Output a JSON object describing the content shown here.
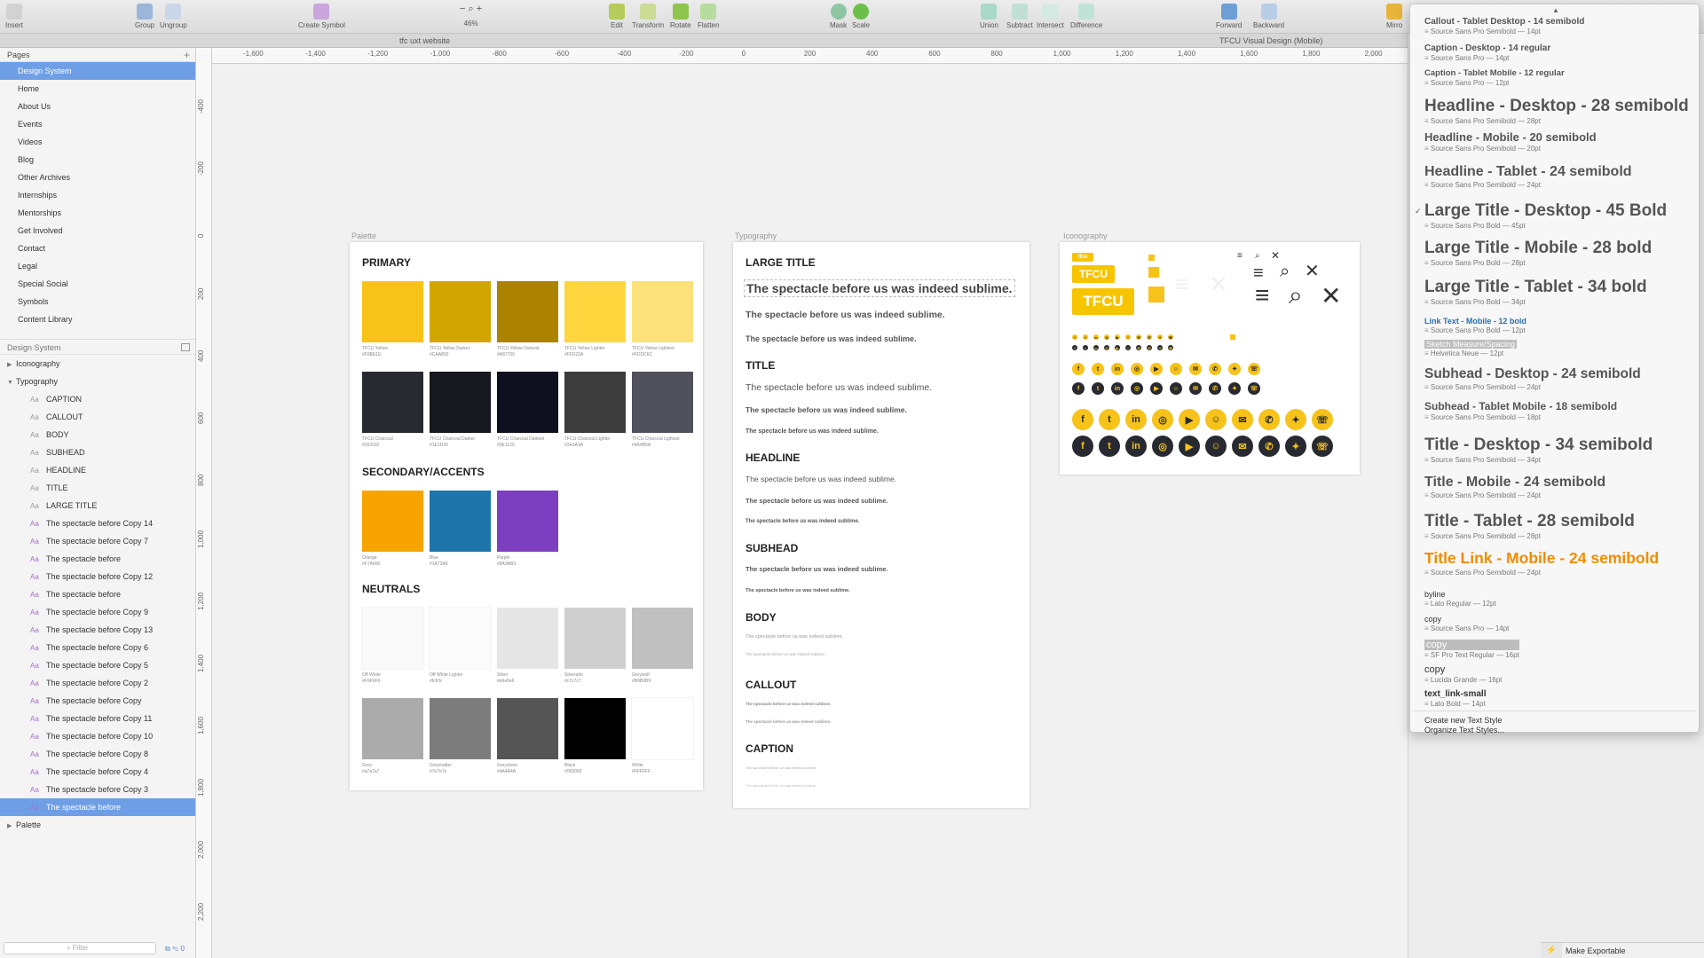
{
  "toolbar": {
    "insert": "Insert",
    "group": "Group",
    "ungroup": "Ungroup",
    "create_symbol": "Create Symbol",
    "zoom_minus": "−",
    "zoom_plus": "+",
    "zoom_level": "46%",
    "edit": "Edit",
    "transform": "Transform",
    "rotate": "Rotate",
    "flatten": "Flatten",
    "mask": "Mask",
    "scale": "Scale",
    "union": "Union",
    "subtract": "Subtract",
    "intersect": "Intersect",
    "difference": "Difference",
    "forward": "Forward",
    "backward": "Backward",
    "mirror": "Mirro"
  },
  "tabs": {
    "left": "tfc uxt website",
    "right": "TFCU Visual Design (Mobile)"
  },
  "pages": {
    "header": "Pages",
    "items": [
      "Design System",
      "Home",
      "About Us",
      "Events",
      "Videos",
      "Blog",
      "Other Archives",
      "Internships",
      "Mentorships",
      "Get Involved",
      "Contact",
      "Legal",
      "Special Social",
      "Symbols",
      "Content Library"
    ]
  },
  "layers": {
    "header": "Design System",
    "iconography": "Iconography",
    "typography": "Typography",
    "typo_children": [
      "CAPTION",
      "CALLOUT",
      "BODY",
      "SUBHEAD",
      "HEADLINE",
      "TITLE",
      "LARGE TITLE"
    ],
    "sym_children": [
      "The spectacle before Copy 14",
      "The spectacle before Copy 7",
      "The spectacle before",
      "The spectacle before Copy 12",
      "The spectacle before",
      "The spectacle before Copy 9",
      "The spectacle before Copy 13",
      "The spectacle before Copy 6",
      "The spectacle before Copy 5",
      "The spectacle before Copy 2",
      "The spectacle before Copy",
      "The spectacle before Copy 11",
      "The spectacle before Copy 10",
      "The spectacle before Copy 8",
      "The spectacle before Copy 4",
      "The spectacle before Copy 3",
      "The spectacle before"
    ],
    "palette": "Palette",
    "filter_placeholder": "Filter",
    "filter_count": "0"
  },
  "ruler_h": [
    "-1,600",
    "-1,400",
    "-1,200",
    "-1,000",
    "-800",
    "-600",
    "-400",
    "-200",
    "0",
    "200",
    "400",
    "600",
    "800",
    "1,000",
    "1,200",
    "1,400",
    "1,600",
    "1,800",
    "2,000"
  ],
  "ruler_v": [
    "-400",
    "-200",
    "0",
    "200",
    "400",
    "600",
    "800",
    "1,000",
    "1,200",
    "1,400",
    "1,600",
    "1,800",
    "2,000",
    "2,200"
  ],
  "artboards": {
    "palette": "Palette",
    "typography": "Typography",
    "iconography": "Iconography"
  },
  "palette": {
    "primary_title": "PRIMARY",
    "primary_row1": [
      {
        "name": "TFCU Yellow",
        "hex": "#F9BE1E",
        "color": "#f7c31b"
      },
      {
        "name": "TFCU Yellow Darker",
        "hex": "#CAA800",
        "color": "#d1a600"
      },
      {
        "name": "TFCU Yellow Darkest",
        "hex": "#A87700",
        "color": "#ab8300"
      },
      {
        "name": "TFCU Yellow Lighter",
        "hex": "#FFD23A",
        "color": "#ffd63d"
      },
      {
        "name": "TFCU Yellow Lightest",
        "hex": "#FDDC6C",
        "color": "#fde17a"
      }
    ],
    "primary_row2": [
      {
        "name": "TFCU Charcoal",
        "hex": "#262932",
        "color": "#272a31"
      },
      {
        "name": "TFCU Charcoal Darker",
        "hex": "#1E1D26",
        "color": "#17181f"
      },
      {
        "name": "TFCU Charcoal Darkest",
        "hex": "#0E1120",
        "color": "#0f1121"
      },
      {
        "name": "TFCU Charcoal Lighter",
        "hex": "#3A3A3A",
        "color": "#3c3c3c"
      },
      {
        "name": "TFCU Charcoal Lightest",
        "hex": "#4A4B5A",
        "color": "#50515c"
      }
    ],
    "secondary_title": "SECONDARY/ACCENTS",
    "secondary": [
      {
        "name": "Orange",
        "hex": "#F7A600",
        "color": "#f7a400"
      },
      {
        "name": "Blue",
        "hex": "#1A73A9",
        "color": "#1d75ab"
      },
      {
        "name": "Purple",
        "hex": "#8A3AB3",
        "color": "#7b3fbf"
      }
    ],
    "neutrals_title": "NEUTRALS",
    "neutral_row1": [
      {
        "name": "Off White",
        "hex": "#F9F9F9",
        "color": "#f9f9f9"
      },
      {
        "name": "Off White Lighter",
        "hex": "#fcfcfc",
        "color": "#fbfbfb"
      },
      {
        "name": "Silver",
        "hex": "#e6e6e6",
        "color": "#e6e6e6"
      },
      {
        "name": "Silverado",
        "hex": "#c7c7c7",
        "color": "#cfcfcf"
      },
      {
        "name": "Greywolf",
        "hex": "#B9B9B9",
        "color": "#c0c0c0"
      }
    ],
    "neutral_row2": [
      {
        "name": "Grey",
        "hex": "#a7a7a7",
        "color": "#ababab"
      },
      {
        "name": "Greymatter",
        "hex": "#7e7e7e",
        "color": "#7c7c7c"
      },
      {
        "name": "Greystone",
        "hex": "#4A4A4A",
        "color": "#555555"
      },
      {
        "name": "Black",
        "hex": "#000000",
        "color": "#000000"
      },
      {
        "name": "White",
        "hex": "#FFFFFF",
        "color": "#ffffff"
      }
    ]
  },
  "typography": {
    "sample": "The spectacle before us was indeed sublime.",
    "large_title": "LARGE TITLE",
    "title": "TITLE",
    "headline": "HEADLINE",
    "subhead": "SUBHEAD",
    "body": "BODY",
    "callout": "CALLOUT",
    "caption": "CAPTION"
  },
  "iconography": {
    "logo_text": "TFCU",
    "logo_small": "tfcu"
  },
  "colors": {
    "accent_yellow": "#f7c31b",
    "charcoal": "#272a31",
    "selection": "#6e9fe6",
    "orange_link": "#f08d00"
  },
  "menu": {
    "items": [
      {
        "t": "Callout - Tablet Desktop - 14 semibold",
        "s": "Source Sans Pro Semibold — 14pt"
      },
      {
        "t": "Caption - Desktop - 14 regular",
        "s": "Source Sans Pro — 14pt"
      },
      {
        "t": "Caption - Tablet Mobile - 12 regular",
        "s": "Source Sans Pro — 12pt"
      },
      {
        "t": "Headline - Desktop - 28 semibold",
        "s": "Source Sans Pro Semibold — 28pt"
      },
      {
        "t": "Headline - Mobile - 20 semibold",
        "s": "Source Sans Pro Semibold — 20pt"
      },
      {
        "t": "Headline - Tablet - 24 semibold",
        "s": "Source Sans Pro Semibold — 24pt"
      },
      {
        "t": "Large Title - Desktop - 45 Bold",
        "s": "Source Sans Pro Bold — 45pt"
      },
      {
        "t": "Large Title - Mobile - 28 bold",
        "s": "Source Sans Pro Bold — 28pt"
      },
      {
        "t": "Large Title - Tablet - 34 bold",
        "s": "Source Sans Pro Bold — 34pt"
      },
      {
        "t": "Link Text - Mobile - 12 bold",
        "s": "Source Sans Pro Bold — 12pt"
      },
      {
        "t": "Sketch Measure/Spacing",
        "s": "Helvetica Neue — 12pt"
      },
      {
        "t": "Subhead - Desktop - 24 semibold",
        "s": "Source Sans Pro Semibold — 24pt"
      },
      {
        "t": "Subhead - Tablet Mobile - 18 semibold",
        "s": "Source Sans Pro Semibold — 18pt"
      },
      {
        "t": "Title - Desktop - 34 semibold",
        "s": "Source Sans Pro Semibold — 34pt"
      },
      {
        "t": "Title - Mobile - 24 semibold",
        "s": "Source Sans Pro Semibold — 24pt"
      },
      {
        "t": "Title - Tablet - 28 semibold",
        "s": "Source Sans Pro Semibold — 28pt"
      },
      {
        "t": "Title Link - Mobile - 24 semibold",
        "s": "Source Sans Pro Semibold — 24pt"
      },
      {
        "t": "byline",
        "s": "Lato Regular — 12pt"
      },
      {
        "t": "copy",
        "s": "Source Sans Pro — 14pt"
      },
      {
        "t": "copy",
        "s": "SF Pro Text Regular — 16pt"
      },
      {
        "t": "copy",
        "s": "Lucida Grande — 16pt"
      },
      {
        "t": "text_link-small",
        "s": "Lato Bold — 14pt"
      }
    ],
    "create": "Create new Text Style",
    "organize": "Organize Text Styles..."
  },
  "inspector": {
    "make_exportable": "Make Exportable"
  }
}
